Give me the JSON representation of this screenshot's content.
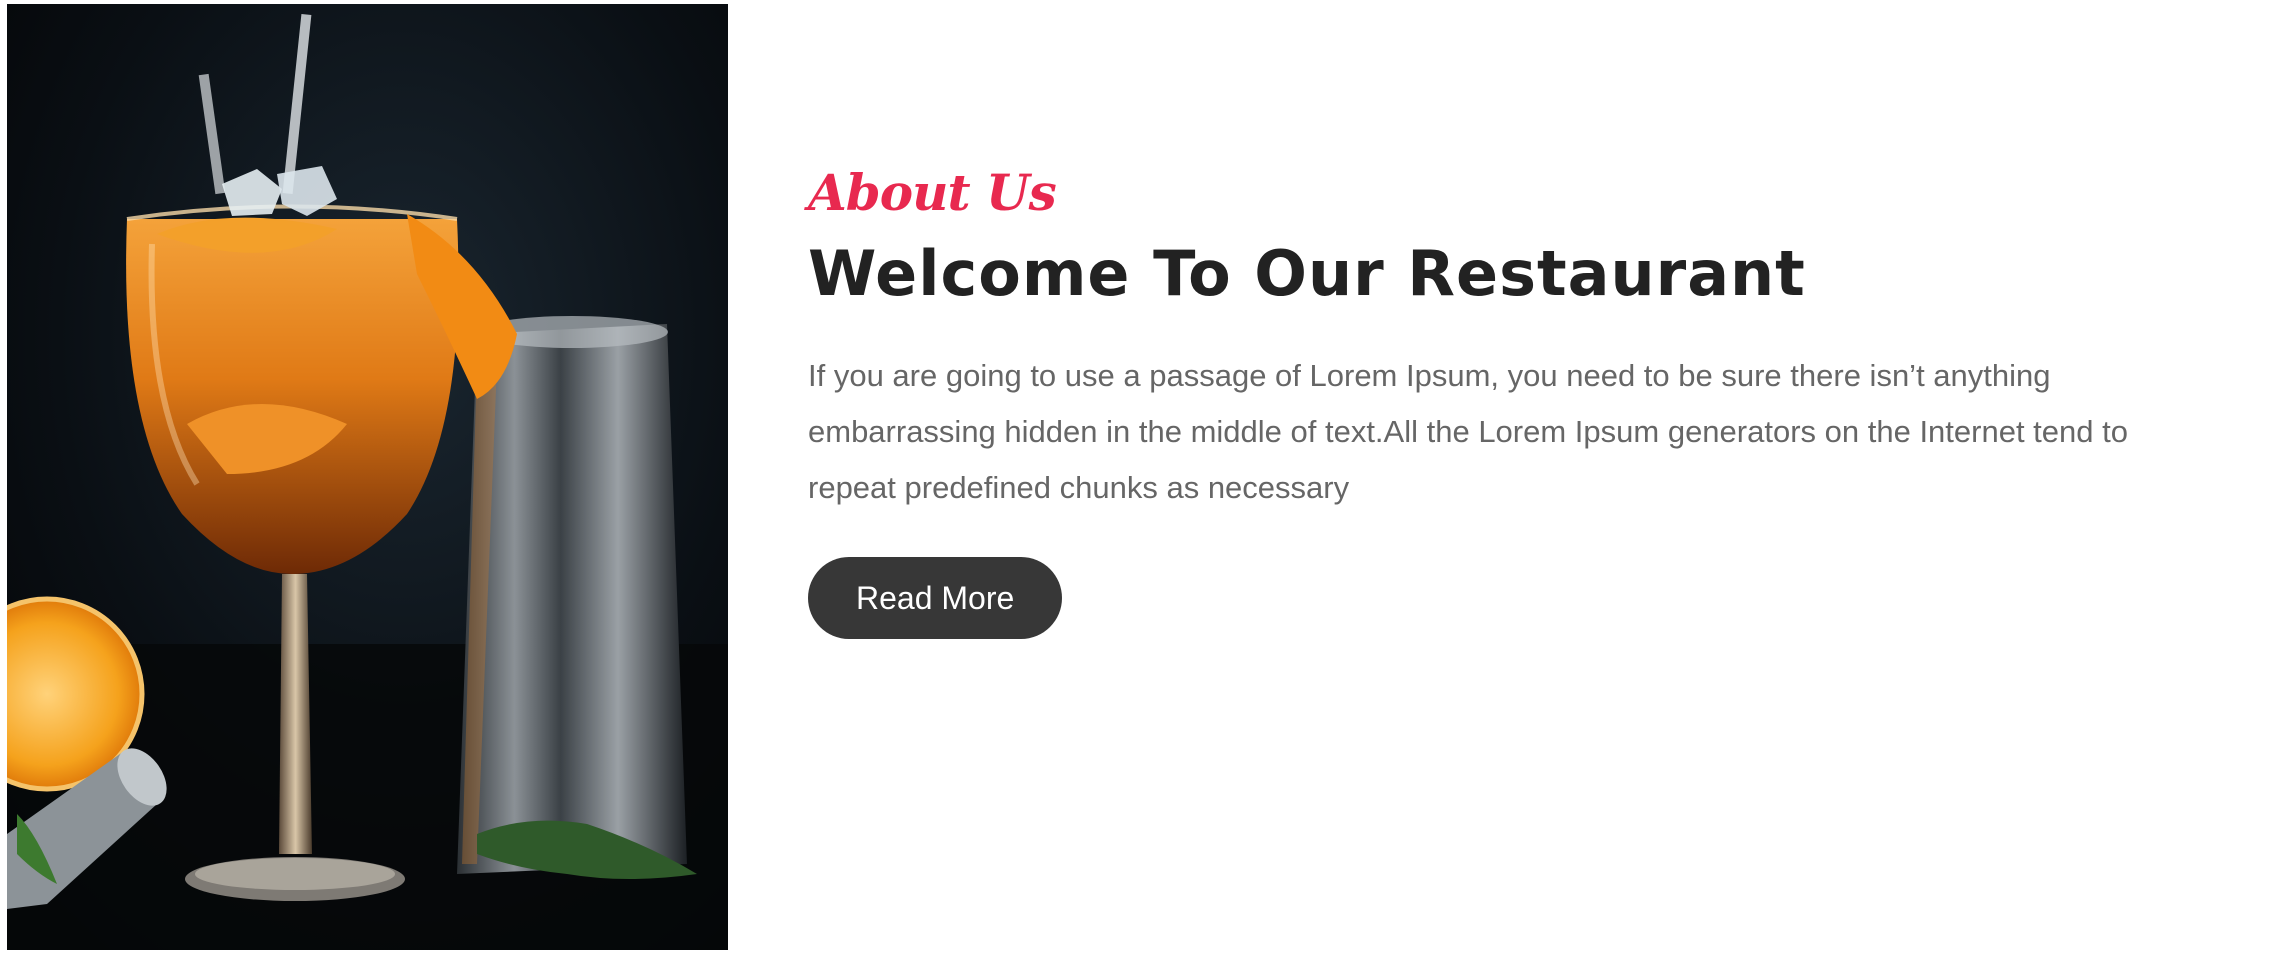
{
  "about": {
    "eyebrow": "About Us",
    "title": "Welcome To Our Restaurant",
    "body": "If you are going to use a passage of Lorem Ipsum, you need to be sure there isn’t anything embarrassing hidden in the middle of text.All the Lorem Ipsum generators on the Internet tend to repeat predefined chunks as necessary",
    "button_label": "Read More"
  },
  "image": {
    "subject": "orange-cocktail-photo"
  },
  "colors": {
    "accent": "#e8294f",
    "heading": "#222222",
    "body": "#666666",
    "button_bg": "#373737",
    "button_text": "#ffffff"
  }
}
